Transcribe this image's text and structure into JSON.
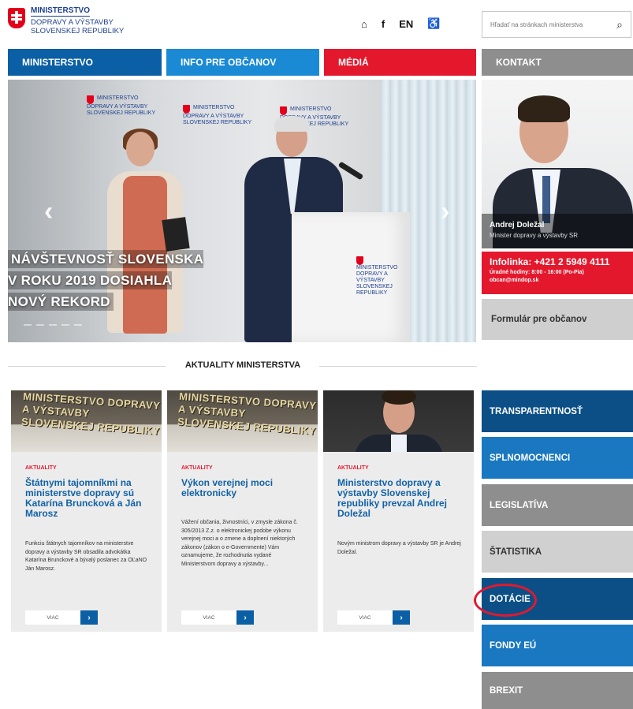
{
  "header": {
    "logo": {
      "line1": "MINISTERSTVO",
      "line2": "DOPRAVY A VÝSTAVBY",
      "line3": "SLOVENSKEJ REPUBLIKY"
    },
    "icons": {
      "home": "⌂",
      "facebook": "f",
      "language": "EN",
      "accessibility": "♿"
    },
    "search": {
      "placeholder": "Hľadať na stránkach ministerstva",
      "icon": "⌕"
    }
  },
  "nav": {
    "items": [
      {
        "label": "MINISTERSTVO"
      },
      {
        "label": "INFO PRE OBČANOV"
      },
      {
        "label": "MÉDIÁ"
      },
      {
        "label": "KONTAKT"
      }
    ]
  },
  "hero": {
    "title": "NÁVŠTEVNOSŤ SLOVENSKA V ROKU 2019 DOSIAHLA NOVÝ REKORD",
    "wall_logo": "MINISTERSTVO DOPRAVY A VÝSTAVBY SLOVENSKEJ REPUBLIKY",
    "prev": "‹",
    "next": "›"
  },
  "profile": {
    "name": "Andrej Doležal",
    "role": "Minister dopravy a výstavby SR"
  },
  "infoline": {
    "title": "Infolinka: +421 2 5949 4111",
    "hours": "Úradné hodiny: 8:00 - 16:00 (Po-Pia)",
    "email": "obcan@mindop.sk"
  },
  "formular": {
    "label": "Formulár pre občanov"
  },
  "section": {
    "title": "AKTUALITY MINISTERSTVA"
  },
  "news": [
    {
      "image_text": "MINISTERSTVO DOPRAVY A VÝSTAVBY SLOVENSKEJ REPUBLIKY",
      "tag": "AKTUALITY",
      "title": "Štátnymi tajomníkmi na ministerstve dopravy sú Katarína Bruncková a Ján Marosz",
      "text": "Funkciu štátnych tajomníkov na ministerstve dopravy a výstavby SR obsadila advokátka Katarína Brunckové a bývalý poslanec za OĽaNO Ján Marosz.",
      "more": "VIAC",
      "go": "›"
    },
    {
      "image_text": "MINISTERSTVO DOPRAVY A VÝSTAVBY SLOVENSKEJ REPUBLIKY",
      "tag": "AKTUALITY",
      "title": "Výkon verejnej moci elektronicky",
      "text": "Vážení občania, živnostníci, v zmysle zákona č. 305/2013 Z.z. o elektronickej podobe výkonu verejnej moci a o zmene a doplnení niektorých zákonov (zákon o e-Governmente) Vám oznamujeme, že rozhodnutia vydané Ministerstvom dopravy a výstavby...",
      "more": "VIAC",
      "go": "›"
    },
    {
      "tag": "AKTUALITY",
      "title": "Ministerstvo dopravy a výstavby Slovenskej republiky prevzal Andrej Doležal",
      "text": "Novým ministrom dopravy a výstavby SR je Andrej Doležal.",
      "more": "VIAC",
      "go": "›"
    }
  ],
  "tiles": [
    {
      "label": "TRANSPARENTNOSŤ"
    },
    {
      "label": "SPLNOMOCNENCI"
    },
    {
      "label": "LEGISLATÍVA"
    },
    {
      "label": "ŠTATISTIKA"
    },
    {
      "label": "DOTÁCIE"
    },
    {
      "label": "FONDY EÚ"
    },
    {
      "label": "BREXIT"
    }
  ]
}
